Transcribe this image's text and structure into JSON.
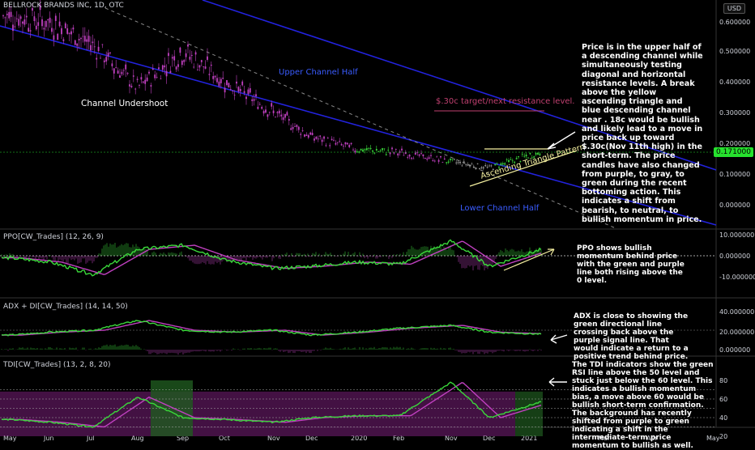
{
  "header": {
    "title": "BELLROCK BRANDS INC, 1D, OTC",
    "currency_badge": "USD",
    "last_price_tag": "0.171000"
  },
  "panes": {
    "price": {
      "y_ticks": [
        "0.600000",
        "0.500000",
        "0.400000",
        "0.300000",
        "0.200000",
        "0.100000",
        "0.000000"
      ],
      "log_scale": true
    },
    "ppo": {
      "label": "PPO[CW_Trades] (12, 26, 9)",
      "y_ticks": [
        "10.000000",
        "0.000000",
        "-10.000000"
      ]
    },
    "adx": {
      "label": "ADX + DI[CW_Trades] (14, 14, 50)",
      "y_ticks": [
        "40.000000",
        "20.000000",
        "0.000000"
      ]
    },
    "tdi": {
      "label": "TDI[CW_Trades] (13, 2, 8, 20)",
      "y_ticks": [
        "80",
        "60",
        "40",
        "20"
      ]
    }
  },
  "x_axis": {
    "ticks": [
      "May",
      "Jun",
      "Jul",
      "Aug",
      "Sep",
      "Oct",
      "Nov",
      "Dec",
      "2020",
      "Feb",
      "Nov",
      "Dec",
      "2021",
      "Mar",
      "Apr",
      "May"
    ]
  },
  "annotations": {
    "channel_undershoot": "Channel Undershoot",
    "upper_channel_half": "Upper Channel Half",
    "lower_channel_half": "Lower Channel Half",
    "target_label": "$.30c target/next resistance level.",
    "ascending_triangle": "Ascending Triangle Pattern",
    "main_note": "Price is in the upper half of a descending channel while simultaneously testing diagonal and horizontal resistance levels. A break above the yellow ascending triangle and blue descending channel near . 18c would be bullish and likely lead to a move in price back up toward $.30c(Nov 11th high) in the short-term.  The price candles have also changed from purple, to gray, to green during the recent bottoming action.  This indicates a shift from bearish, to neutral, to bullish momentum in price.",
    "ppo_note": "PPO shows bullish momentum behind price with the green and purple line both rising above the 0 level.",
    "adx_note": "ADX is close to showing the green directional line crossing back above the purple signal line. That would indicate a return to a positive trend behind price.",
    "tdi_note": "The TDI indicators show the green RSI line above the 50 level and stuck just below the 60 level.  This indicates a bullish momentum bias, a move above 60 would be bullish short-term confirmation.  The background has recently shifted from purple to green indicating a shift in the intermediate-term price momentum to bullish as well."
  },
  "colors": {
    "bearish": "#c040c0",
    "neutral": "#9a9a9a",
    "bullish": "#3ad83a",
    "channel": "#2222dd",
    "triangle": "#f5f0a0",
    "target": "#c04070"
  },
  "chart_data": [
    {
      "type": "candlestick",
      "name": "price",
      "x": [
        "May",
        "Jun",
        "Jul",
        "Aug",
        "Sep",
        "Oct",
        "Nov",
        "Dec",
        "2020",
        "Feb",
        "Nov",
        "Dec",
        "2021"
      ],
      "close": [
        0.62,
        0.6,
        0.52,
        0.38,
        0.5,
        0.4,
        0.3,
        0.22,
        0.18,
        0.17,
        0.14,
        0.12,
        0.171
      ],
      "ylim": [
        0.0,
        0.65
      ],
      "levels": {
        "target": 0.3,
        "horizontal_resistance": 0.18
      }
    },
    {
      "type": "line",
      "name": "PPO",
      "x": [
        "May",
        "Jun",
        "Jul",
        "Aug",
        "Sep",
        "Oct",
        "Nov",
        "Dec",
        "2020",
        "Feb",
        "Nov",
        "Dec",
        "2021"
      ],
      "values": [
        -1,
        -3,
        -9,
        3,
        5,
        -2,
        -6,
        -5,
        -3,
        -4,
        7,
        -5,
        3
      ],
      "ylim": [
        -15,
        12
      ]
    },
    {
      "type": "line",
      "name": "ADX + DI",
      "x": [
        "May",
        "Jun",
        "Jul",
        "Aug",
        "Sep",
        "Oct",
        "Nov",
        "Dec",
        "2020",
        "Feb",
        "Nov",
        "Dec",
        "2021"
      ],
      "values": [
        15,
        18,
        20,
        30,
        20,
        18,
        20,
        15,
        18,
        22,
        25,
        18,
        16
      ],
      "ylim": [
        0,
        50
      ]
    },
    {
      "type": "line",
      "name": "TDI",
      "x": [
        "May",
        "Jun",
        "Jul",
        "Aug",
        "Sep",
        "Oct",
        "Nov",
        "Dec",
        "2020",
        "Feb",
        "Nov",
        "Dec",
        "2021"
      ],
      "values": [
        38,
        35,
        30,
        62,
        40,
        38,
        35,
        40,
        42,
        42,
        78,
        40,
        57
      ],
      "ylim": [
        15,
        85
      ]
    }
  ]
}
